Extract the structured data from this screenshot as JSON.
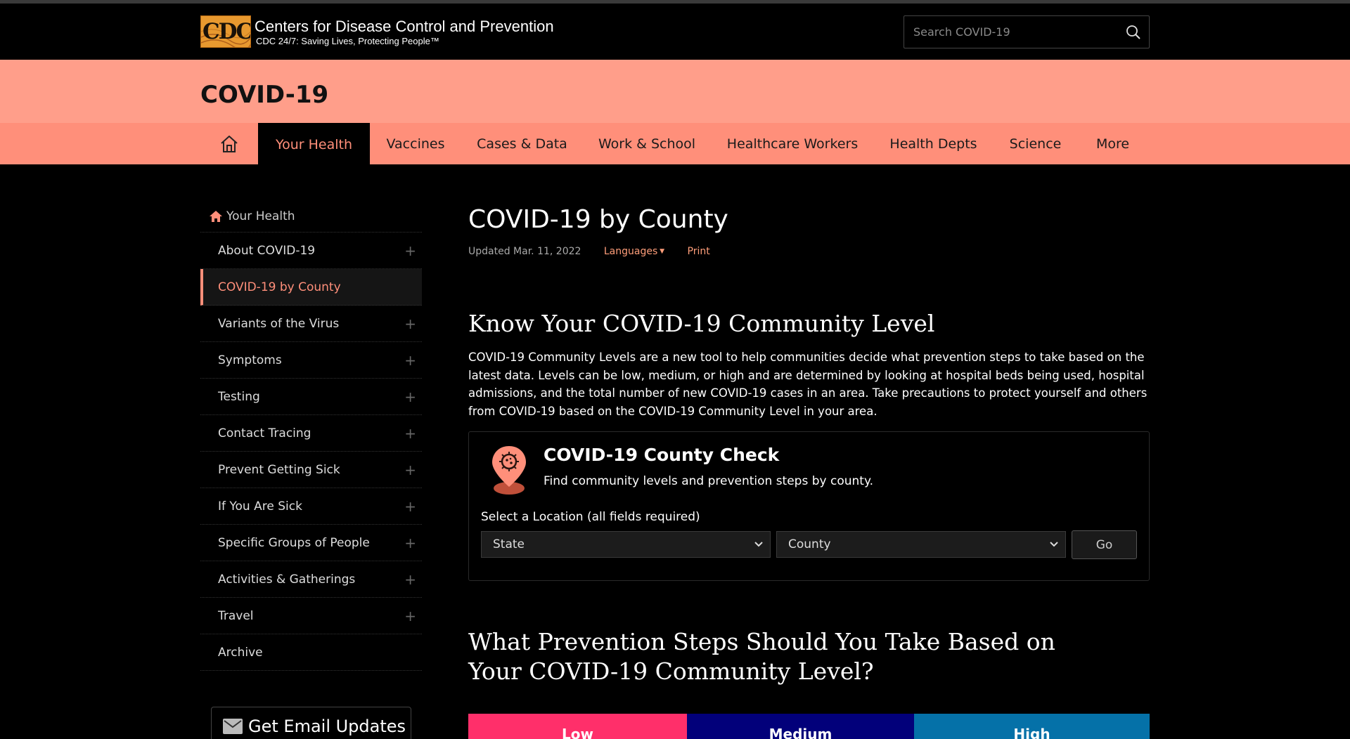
{
  "header": {
    "logo_text": "CDC",
    "agency_name": "Centers for Disease Control and Prevention",
    "tagline": "CDC 24/7: Saving Lives, Protecting People™",
    "search_placeholder": "Search COVID-19"
  },
  "site": {
    "title": "COVID-19"
  },
  "nav": {
    "items": [
      {
        "label": "Your Health"
      },
      {
        "label": "Vaccines"
      },
      {
        "label": "Cases & Data"
      },
      {
        "label": "Work & School"
      },
      {
        "label": "Healthcare Workers"
      },
      {
        "label": "Health Depts"
      },
      {
        "label": "Science"
      },
      {
        "label": "More"
      }
    ]
  },
  "sidebar": {
    "home_label": "Your Health",
    "items": [
      {
        "label": "About COVID-19"
      },
      {
        "label": "COVID-19 by County"
      },
      {
        "label": "Variants of the Virus"
      },
      {
        "label": "Symptoms"
      },
      {
        "label": "Testing"
      },
      {
        "label": "Contact Tracing"
      },
      {
        "label": "Prevent Getting Sick"
      },
      {
        "label": "If You Are Sick"
      },
      {
        "label": "Specific Groups of People"
      },
      {
        "label": "Activities & Gatherings"
      },
      {
        "label": "Travel"
      },
      {
        "label": "Archive"
      }
    ],
    "email_button": "Get Email Updates"
  },
  "main": {
    "page_title": "COVID-19 by County",
    "updated": "Updated Mar. 11, 2022",
    "languages": "Languages",
    "print": "Print",
    "section1_heading": "Know Your COVID-19 Community Level",
    "section1_text": "COVID-19 Community Levels are a new tool to help communities decide what prevention steps to take based on the latest data. Levels can be low, medium, or high and are determined by looking at hospital beds being used, hospital admissions, and the total number of new COVID-19 cases in an area. Take precautions to protect yourself and others from COVID-19 based on the COVID-19 Community Level in your area.",
    "county_check": {
      "title": "COVID-19 County Check",
      "subtitle": "Find community levels and prevention steps by county.",
      "location_label": "Select a Location (all fields required)",
      "state_value": "State",
      "county_value": "County",
      "go_label": "Go"
    },
    "section2_heading": "What Prevention Steps Should You Take Based on Your COVID-19 Community Level?",
    "levels": [
      {
        "label": "Low",
        "color": "#ff2f6a"
      },
      {
        "label": "Medium",
        "color": "#02007a"
      },
      {
        "label": "High",
        "color": "#0571a8"
      }
    ]
  },
  "colors": {
    "accent": "#ff8f7a",
    "title_band": "#ff9e8a",
    "nav_band": "#ff8f7a",
    "link": "#ff9e7a"
  }
}
